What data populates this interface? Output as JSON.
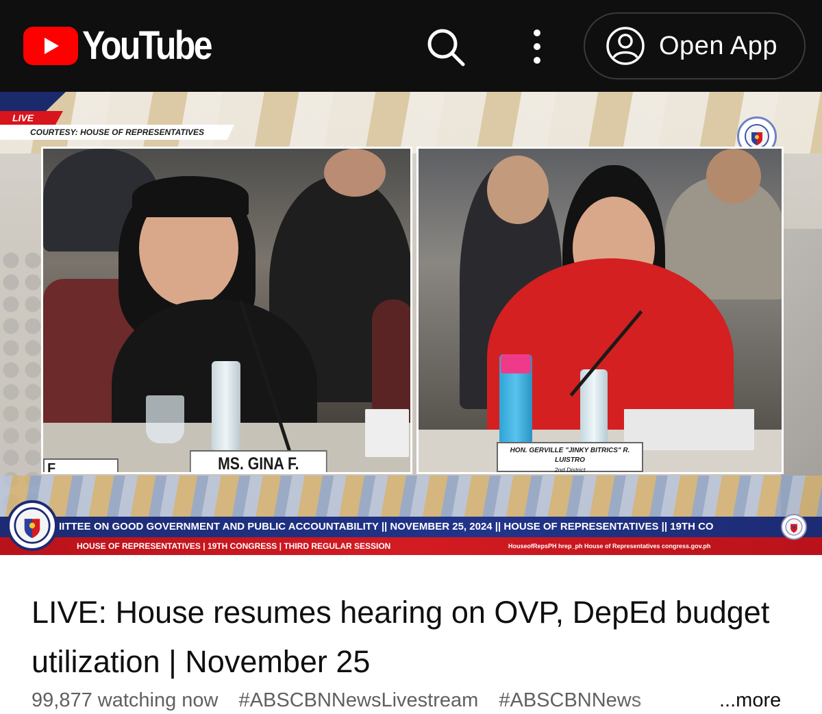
{
  "appbar": {
    "logo_text": "YouTube",
    "open_app_label": "Open App",
    "background": "#0f0f0f",
    "brand_red": "#ff0000"
  },
  "player": {
    "live_tag": "LIVE",
    "courtesy": "COURTESY: HOUSE OF REPRESENTATIVES",
    "nameplate_left": "MS. GINA F. ACOSTA",
    "nameplate_fajarda": "F FAJARDA",
    "nameplate_right": "HON. GERVILLE \"JINKY BITRICS\" R. LUISTRO",
    "nameplate_right_sub": "2nd District",
    "lower_third": "IITTEE ON GOOD GOVERNMENT AND PUBLIC ACCOUNTABILITY  ||  NOVEMBER 25, 2024  ||  HOUSE OF REPRESENTATIVES  ||  19TH CO",
    "sub_third_left": "HOUSE OF REPRESENTATIVES | 19TH CONGRESS | THIRD REGULAR SESSION",
    "sub_third_right": "HouseofRepsPH  hrep_ph  House of Representatives  congress.gov.ph",
    "accent_blue": "#1c2b73",
    "accent_red": "#d31b22"
  },
  "video": {
    "title": "LIVE: House resumes hearing on OVP, DepEd budget utilization | November 25",
    "watching": "99,877 watching now",
    "hashtags": [
      "#ABSCBNNewsLivestream",
      "#ABSCBNNews"
    ],
    "more_label": "...more"
  }
}
